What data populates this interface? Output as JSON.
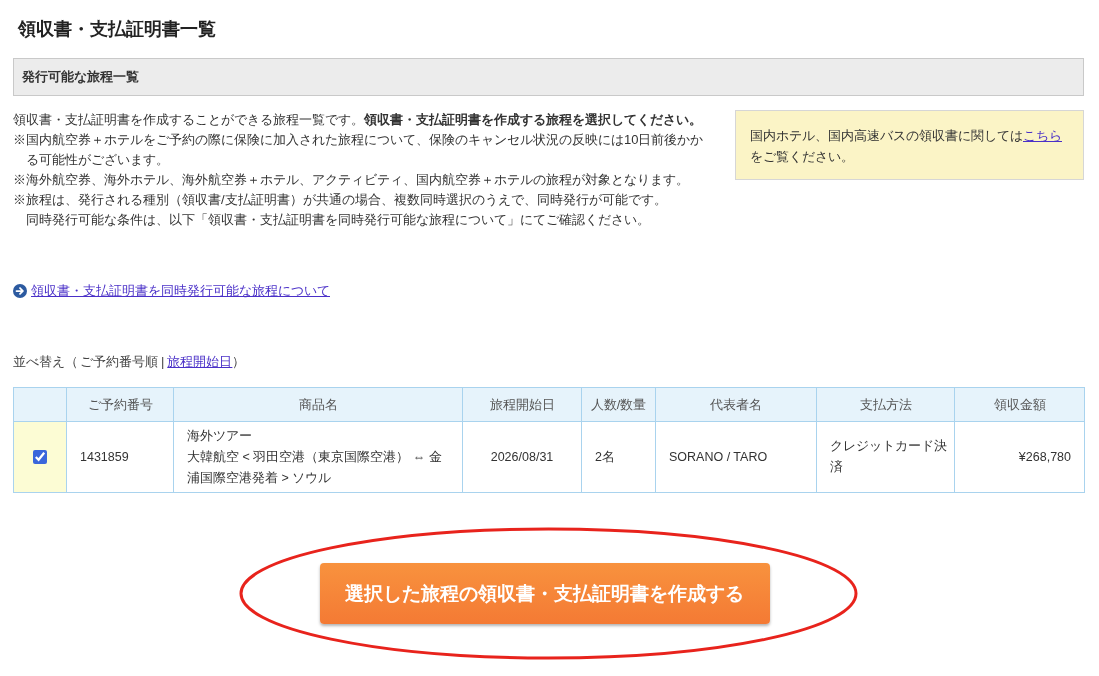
{
  "page_title": "領収書・支払証明書一覧",
  "section": {
    "title": "発行可能な旅程一覧"
  },
  "intro": "領収書・支払証明書を作成することができる旅程一覧です。**領収書・支払証明書を作成する旅程を選択してください。**",
  "notes": [
    [
      "※国内航空券＋ホテルをご予約の際に保険に加入された旅程について、保険のキャンセル状況の反映には10日前後かかる可能性がございます。"
    ],
    [
      "※海外航空券、海外ホテル、海外航空券＋ホテル、アクティビティ、国内航空券＋ホテルの旅程が対象となります。"
    ],
    [
      "※旅程は、発行される種別（領収書/支払証明書）が共通の場合、複数同時選択のうえで、同時発行が可能です。",
      "同時発行可能な条件は、以下「領収書・支払証明書を同時発行可能な旅程について」にてご確認ください。"
    ]
  ],
  "info_box": {
    "text": "国内ホテル、国内高速バスの領収書に関しては",
    "link": "こちら",
    "text_after": "をご覧ください。"
  },
  "related_link": {
    "label": "領収書・支払証明書を同時発行可能な旅程について"
  },
  "sort": {
    "label": "並べ替え（",
    "separator": "|",
    "close": "）",
    "options": [
      {
        "label": "ご予約番号順",
        "selected": true
      },
      {
        "label": "旅程開始日",
        "selected": false
      }
    ]
  },
  "table": {
    "columns": [
      "ご予約番号",
      "商品名",
      "旅程開始日",
      "人数/数量",
      "代表者名",
      "支払方法",
      "領収金額"
    ],
    "rows": [
      {
        "selected": true,
        "cells": [
          "1431859",
          [
            "海外ツアー",
            "大韓航空 < 羽田空港（東京国際空港） ⇔ 金浦国際空港発着 > ソウル"
          ],
          "2026/08/31",
          "2名",
          "SORANO / TARO",
          "クレジットカード決済",
          "¥268,780"
        ]
      }
    ]
  },
  "create_button": {
    "label": "選択した旅程の領収書・支払証明書を作成する",
    "circled": true
  }
}
